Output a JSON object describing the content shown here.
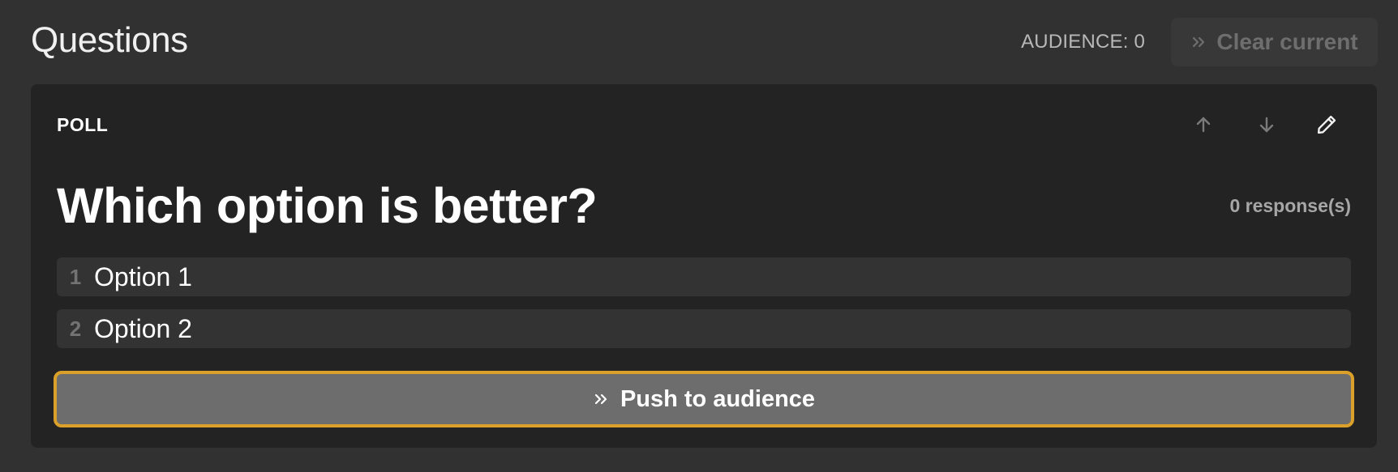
{
  "header": {
    "title": "Questions",
    "audience_label": "AUDIENCE: 0",
    "clear_label": "Clear current"
  },
  "card": {
    "type_label": "POLL",
    "question": "Which option is better?",
    "responses": "0 response(s)",
    "options": [
      {
        "number": "1",
        "label": "Option 1"
      },
      {
        "number": "2",
        "label": "Option 2"
      }
    ],
    "push_label": "Push to audience"
  },
  "icons": {
    "clear": "double-chevron-right-icon",
    "move_up": "arrow-up-icon",
    "move_down": "arrow-down-icon",
    "edit": "pencil-icon",
    "push": "double-chevron-right-icon"
  },
  "colors": {
    "background": "#313131",
    "card": "#232323",
    "option_row": "#333333",
    "push_button": "#6d6d6d",
    "focus_ring": "#daa02a"
  }
}
